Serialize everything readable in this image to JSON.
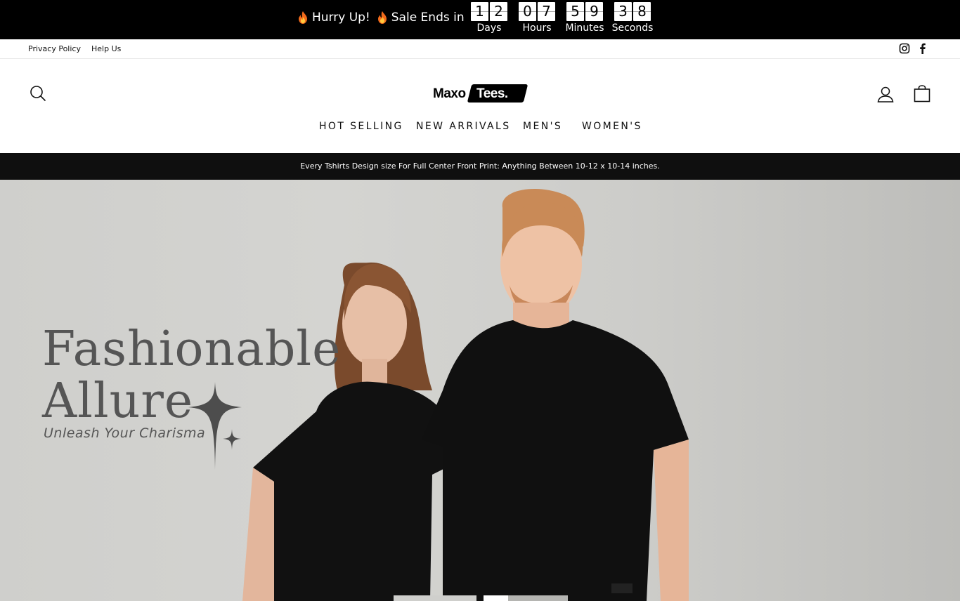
{
  "countdown": {
    "message_1": "Hurry Up!",
    "message_2": "Sale Ends in",
    "flame_icon": "flame-icon",
    "units": [
      {
        "digits": [
          "1",
          "2"
        ],
        "label": "Days"
      },
      {
        "digits": [
          "0",
          "7"
        ],
        "label": "Hours"
      },
      {
        "digits": [
          "5",
          "9"
        ],
        "label": "Minutes"
      },
      {
        "digits": [
          "3",
          "8"
        ],
        "label": "Seconds"
      }
    ]
  },
  "utility": {
    "links": [
      "Privacy Policy",
      "Help Us"
    ],
    "social_icons": [
      "instagram-icon",
      "facebook-icon"
    ]
  },
  "header": {
    "logo_left": "Maxo",
    "logo_right": "Tees.",
    "icons": [
      "search-icon",
      "account-icon",
      "cart-icon"
    ],
    "nav": [
      "HOT SELLING",
      "NEW ARRIVALS",
      "MEN'S",
      "WOMEN'S"
    ]
  },
  "announcement": "Every Tshirts Design size For Full Center Front Print: Anything Between 10-12 x 10-14 inches.",
  "hero": {
    "title_line1": "Fashionable",
    "title_line2": "Allure",
    "subtitle": "Unleash Your Charisma",
    "slides": 3,
    "active_slide": 1
  },
  "colors": {
    "topbar": "#000000",
    "announcement_bg": "#0f0f0f",
    "hero_text": "#555555"
  }
}
